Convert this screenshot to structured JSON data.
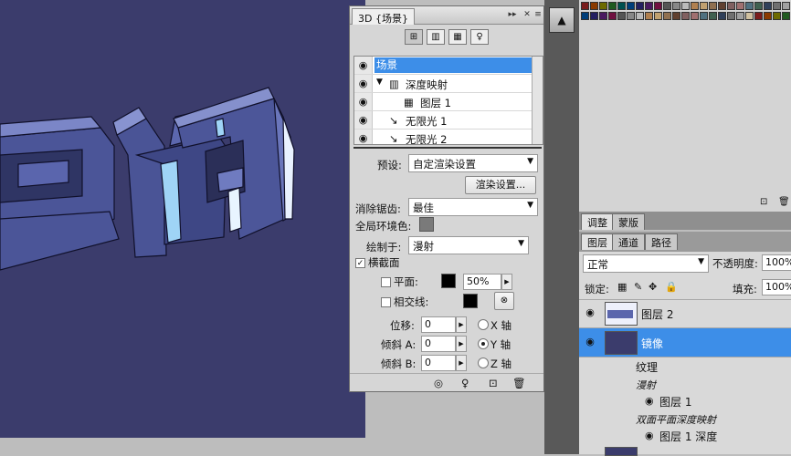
{
  "panel3d": {
    "tab_label": "3D {场景}",
    "tree": [
      {
        "label": "场景",
        "selected": true
      },
      {
        "label": "深度映射",
        "selected": false
      },
      {
        "label": "图层 1",
        "selected": false
      },
      {
        "label": "无限光 1",
        "selected": false
      },
      {
        "label": "无限光 2",
        "selected": false
      }
    ],
    "preset_label": "预设:",
    "preset_value": "自定渲染设置",
    "render_settings_button": "渲染设置...",
    "antialias_label": "消除锯齿:",
    "antialias_value": "最佳",
    "global_ambient_label": "全局环境色:",
    "paint_on_label": "绘制于:",
    "paint_on_value": "漫射",
    "cross_section_label": "横截面",
    "plane_label": "平面:",
    "plane_opacity": "50%",
    "intersection_label": "相交线:",
    "offset_label": "位移:",
    "offset_value": "0",
    "tilt_a_label": "倾斜 A:",
    "tilt_a_value": "0",
    "tilt_b_label": "倾斜 B:",
    "tilt_b_value": "0",
    "x_axis": "X 轴",
    "y_axis": "Y 轴",
    "z_axis": "Z 轴"
  },
  "right": {
    "adjust_tabs": [
      "调整",
      "蒙版"
    ],
    "layer_tabs": [
      "图层",
      "通道",
      "路径"
    ],
    "blend_mode": "正常",
    "opacity_label": "不透明度:",
    "opacity_value": "100%",
    "lock_label": "锁定:",
    "fill_label": "填充:",
    "fill_value": "100%",
    "layers": {
      "layer2": "图层 2",
      "mirror": "镜像",
      "texture": "纹理",
      "diffuse": "漫射",
      "diffuse_layer": "图层 1",
      "depth_map": "双面平面深度映射",
      "depth_layer": "图层 1 深度"
    }
  },
  "colors": {
    "canvas_bg": "#3b3c6c",
    "selection": "#3d8ee8",
    "accent_blue": "#9fd4f6"
  }
}
